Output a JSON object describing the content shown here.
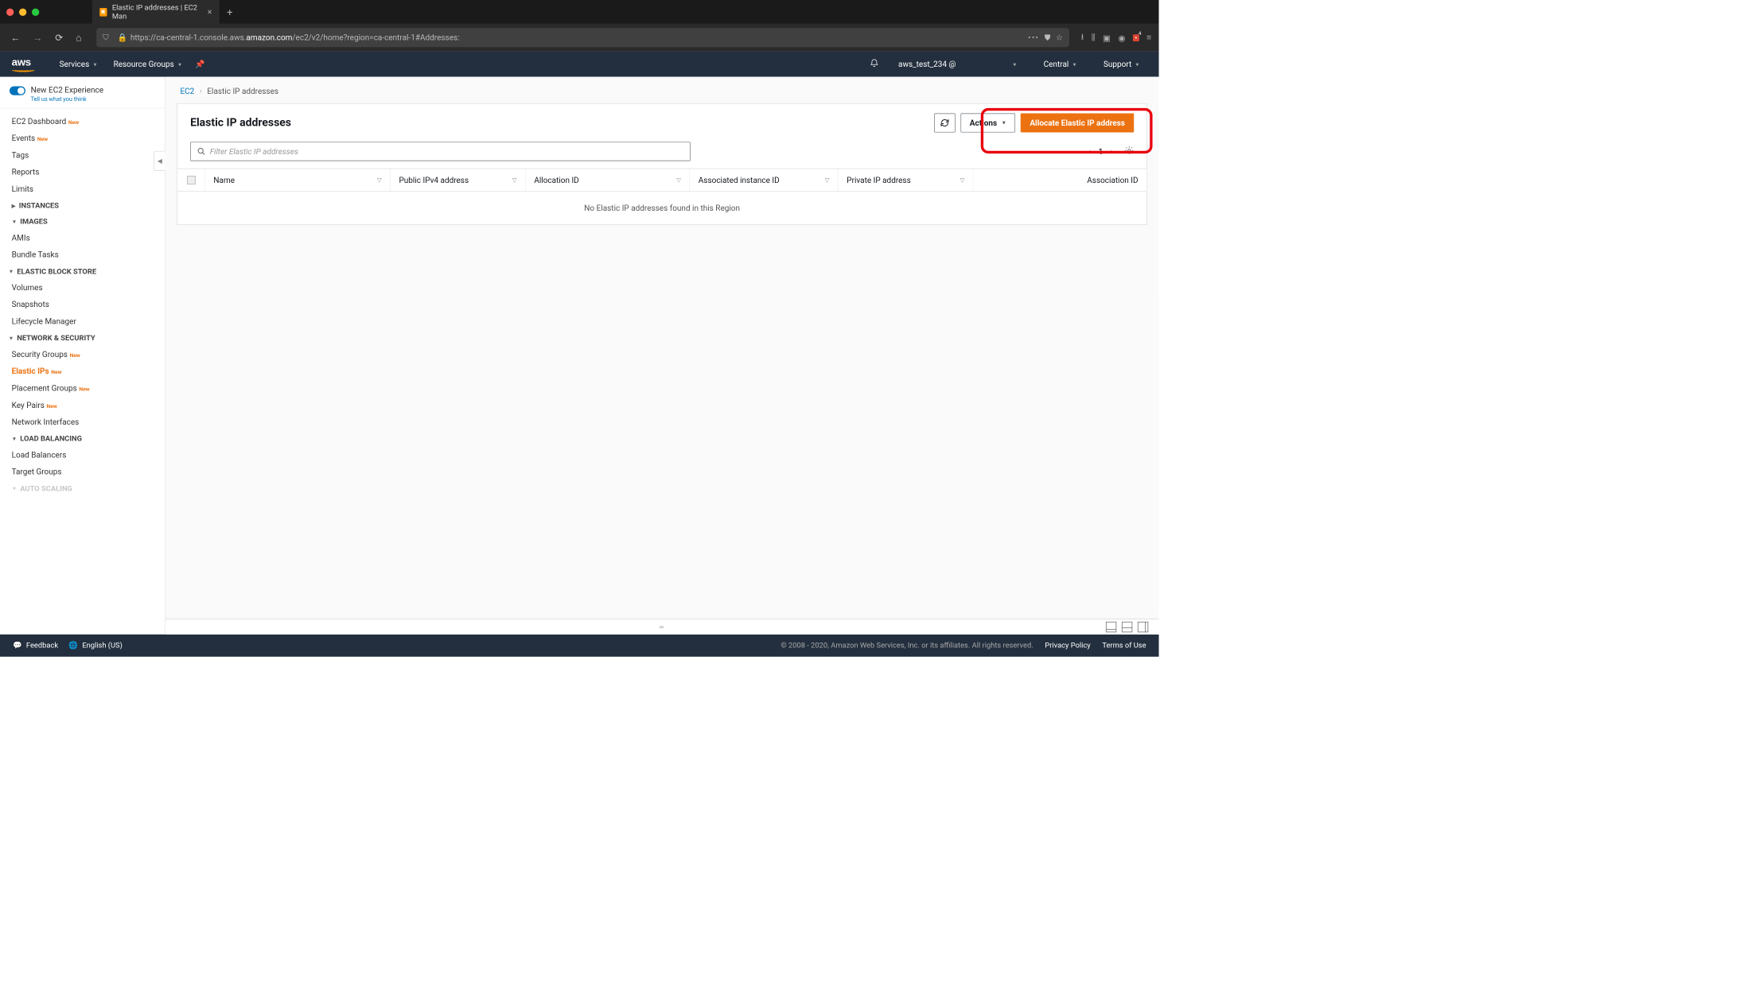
{
  "browser": {
    "tab_title": "Elastic IP addresses | EC2 Man",
    "url_prefix": "https://ca-central-1.console.aws.",
    "url_bold": "amazon.com",
    "url_suffix": "/ec2/v2/home?region=ca-central-1#Addresses:"
  },
  "awsnav": {
    "services": "Services",
    "resource_groups": "Resource Groups",
    "user": "aws_test_234 @",
    "region": "Central",
    "support": "Support"
  },
  "sidebar": {
    "new_exp_title": "New EC2 Experience",
    "new_exp_sub": "Tell us what you think",
    "links_top": [
      {
        "label": "EC2 Dashboard",
        "new": true
      },
      {
        "label": "Events",
        "new": true
      },
      {
        "label": "Tags",
        "new": false
      },
      {
        "label": "Reports",
        "new": false
      },
      {
        "label": "Limits",
        "new": false
      }
    ],
    "sec_instances": "INSTANCES",
    "sec_images": "IMAGES",
    "links_images": [
      {
        "label": "AMIs"
      },
      {
        "label": "Bundle Tasks"
      }
    ],
    "sec_ebs": "ELASTIC BLOCK STORE",
    "links_ebs": [
      {
        "label": "Volumes"
      },
      {
        "label": "Snapshots"
      },
      {
        "label": "Lifecycle Manager"
      }
    ],
    "sec_network": "NETWORK & SECURITY",
    "links_network": [
      {
        "label": "Security Groups",
        "new": true,
        "active": false
      },
      {
        "label": "Elastic IPs",
        "new": true,
        "active": true
      },
      {
        "label": "Placement Groups",
        "new": true,
        "active": false
      },
      {
        "label": "Key Pairs",
        "new": true,
        "active": false
      },
      {
        "label": "Network Interfaces",
        "new": false,
        "active": false
      }
    ],
    "sec_lb": "LOAD BALANCING",
    "links_lb": [
      {
        "label": "Load Balancers"
      },
      {
        "label": "Target Groups"
      }
    ],
    "sec_autoscaling": "AUTO SCALING"
  },
  "breadcrumb": {
    "root": "EC2",
    "current": "Elastic IP addresses"
  },
  "panel": {
    "title": "Elastic IP addresses",
    "actions_label": "Actions",
    "allocate_label": "Allocate Elastic IP address",
    "filter_placeholder": "Filter Elastic IP addresses",
    "page_num": "1",
    "columns": [
      "Name",
      "Public IPv4 address",
      "Allocation ID",
      "Associated instance ID",
      "Private IP address",
      "Association ID"
    ],
    "empty_message": "No Elastic IP addresses found in this Region"
  },
  "footer": {
    "feedback": "Feedback",
    "language": "English (US)",
    "copyright": "© 2008 - 2020, Amazon Web Services, Inc. or its affiliates. All rights reserved.",
    "privacy": "Privacy Policy",
    "terms": "Terms of Use"
  }
}
